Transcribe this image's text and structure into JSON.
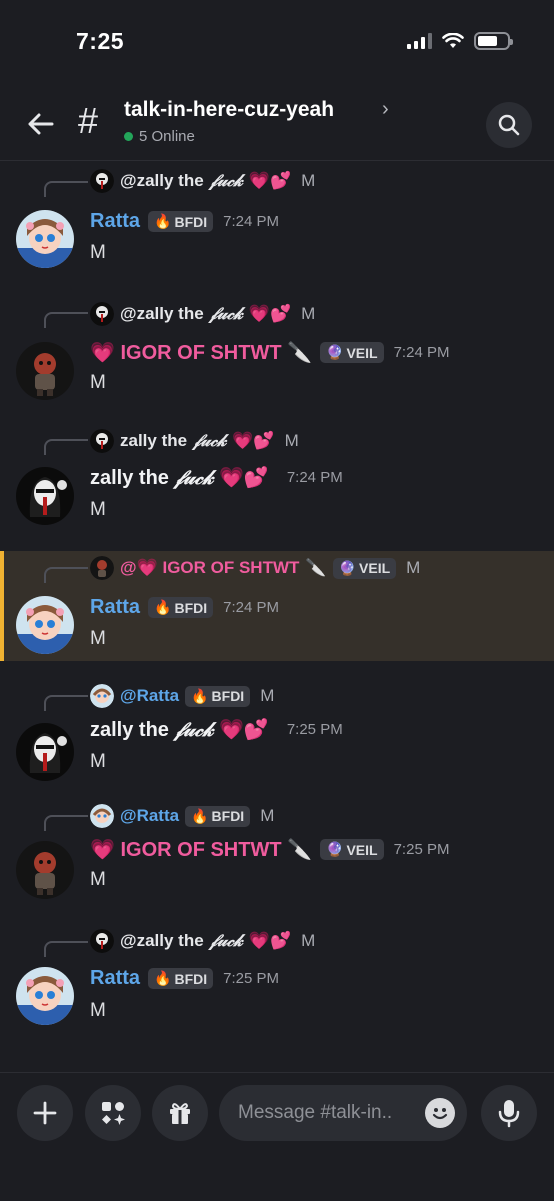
{
  "status_bar": {
    "time": "7:25"
  },
  "header": {
    "channel_name": "talk-in-here-cuz-yeah",
    "chevron": "›",
    "online": "5 Online"
  },
  "messages": [
    {
      "reply": {
        "name": "@zally the",
        "script": "𝒻𝓊𝒸𝓀",
        "hearts": "💗💕",
        "text": "M"
      },
      "author": "Ratta",
      "tag_emoji": "🔥",
      "tag": "BFDI",
      "time": "7:24 PM",
      "body": "M"
    },
    {
      "reply": {
        "name": "@zally the",
        "script": "𝒻𝓊𝒸𝓀",
        "hearts": "💗💕",
        "text": "M"
      },
      "author_prefix": "💗",
      "author": "IGOR OF SHTWT",
      "author_suffix": "🔪",
      "tag_emoji": "🔮",
      "tag": "VEIL",
      "time": "7:24 PM",
      "body": "M"
    },
    {
      "reply": {
        "name": "zally the",
        "script": "𝒻𝓊𝒸𝓀",
        "hearts": "💗💕",
        "text": "M"
      },
      "author": "zally the",
      "author_script": "𝒻𝓊𝒸𝓀",
      "author_hearts": "💗💕",
      "time": "7:24 PM",
      "body": "M"
    },
    {
      "reply": {
        "name": "@💗 IGOR OF SHTWT",
        "suffix": "🔪",
        "tag_emoji": "🔮",
        "tag": "VEIL",
        "text": "M"
      },
      "author": "Ratta",
      "tag_emoji": "🔥",
      "tag": "BFDI",
      "time": "7:24 PM",
      "body": "M"
    },
    {
      "reply": {
        "name": "@Ratta",
        "tag_emoji": "🔥",
        "tag": "BFDI",
        "text": "M"
      },
      "author": "zally the",
      "author_script": "𝒻𝓊𝒸𝓀",
      "author_hearts": "💗💕",
      "time": "7:25 PM",
      "body": "M"
    },
    {
      "reply": {
        "name": "@Ratta",
        "tag_emoji": "🔥",
        "tag": "BFDI",
        "text": "M"
      },
      "author_prefix": "💗",
      "author": "IGOR OF SHTWT",
      "author_suffix": "🔪",
      "tag_emoji": "🔮",
      "tag": "VEIL",
      "time": "7:25 PM",
      "body": "M"
    },
    {
      "reply": {
        "name": "@zally the",
        "script": "𝒻𝓊𝒸𝓀",
        "hearts": "💗💕",
        "text": "M"
      },
      "author": "Ratta",
      "tag_emoji": "🔥",
      "tag": "BFDI",
      "time": "7:25 PM",
      "body": "M"
    }
  ],
  "composer": {
    "placeholder": "Message #talk-in.."
  },
  "colors": {
    "background": "#1c1d22",
    "ratta_name": "#5ea6e8",
    "igor_name": "#f05c9e",
    "highlight_bg": "#35302a",
    "highlight_bar": "#f0b232",
    "online_dot": "#23a55a"
  }
}
